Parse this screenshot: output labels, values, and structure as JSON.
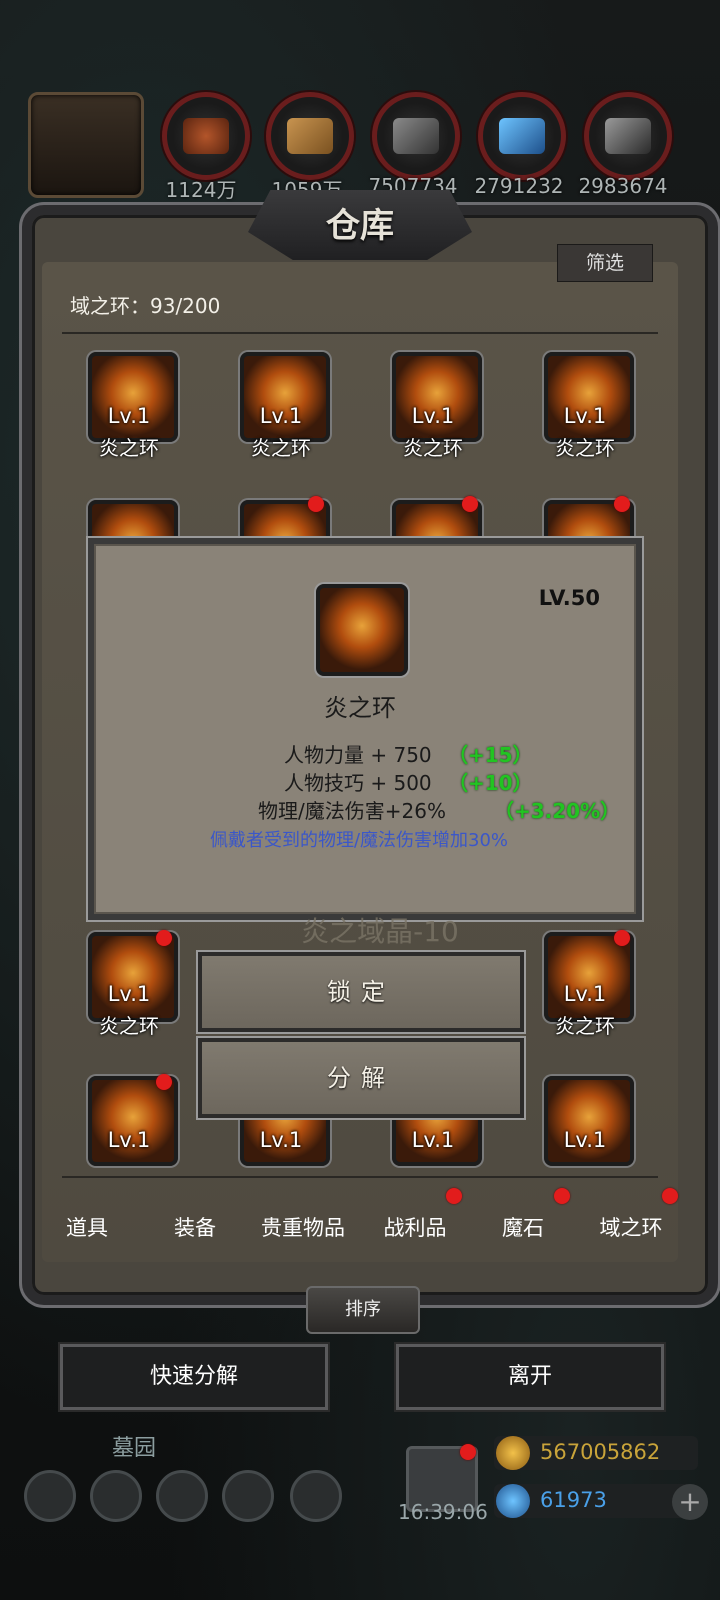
{
  "resources": [
    {
      "icon": "ore-icon",
      "value": "1124万"
    },
    {
      "icon": "wood-icon",
      "value": "1059万"
    },
    {
      "icon": "iron-icon",
      "value": "7507734"
    },
    {
      "icon": "crystal-icon",
      "value": "2791232"
    },
    {
      "icon": "metal-ingot-icon",
      "value": "2983674"
    }
  ],
  "window": {
    "title": "仓库",
    "filter_label": "筛选"
  },
  "storage": {
    "count_label": "域之环：93/200"
  },
  "item_level": "Lv.1",
  "item_name": "炎之环",
  "tooltip": {
    "level": "LV.50",
    "name": "炎之环",
    "stats": [
      {
        "text": "人物力量 + 750",
        "bonus": "（+15）"
      },
      {
        "text": "人物技巧 + 500",
        "bonus": "（+10）"
      },
      {
        "text": "物理/魔法伤害+26%",
        "bonus": "（+3.20%）"
      }
    ],
    "special": "佩戴者受到的物理/魔法伤害增加30%"
  },
  "ghost_text": "炎之域晶-10",
  "actions": {
    "lock": "锁定",
    "decompose": "分解"
  },
  "tabs": [
    "道具",
    "装备",
    "贵重物品",
    "战利品",
    "魔石",
    "域之环"
  ],
  "sort_label": "排序",
  "footer": {
    "quick_decompose": "快速分解",
    "leave": "离开"
  },
  "hud": {
    "zone": "墓园",
    "time": "16:39:06",
    "gold": "567005862",
    "gems": "61973"
  },
  "colors": {
    "bonus": "#22c422",
    "special": "#3b57c8",
    "notification": "#e21c1c"
  }
}
